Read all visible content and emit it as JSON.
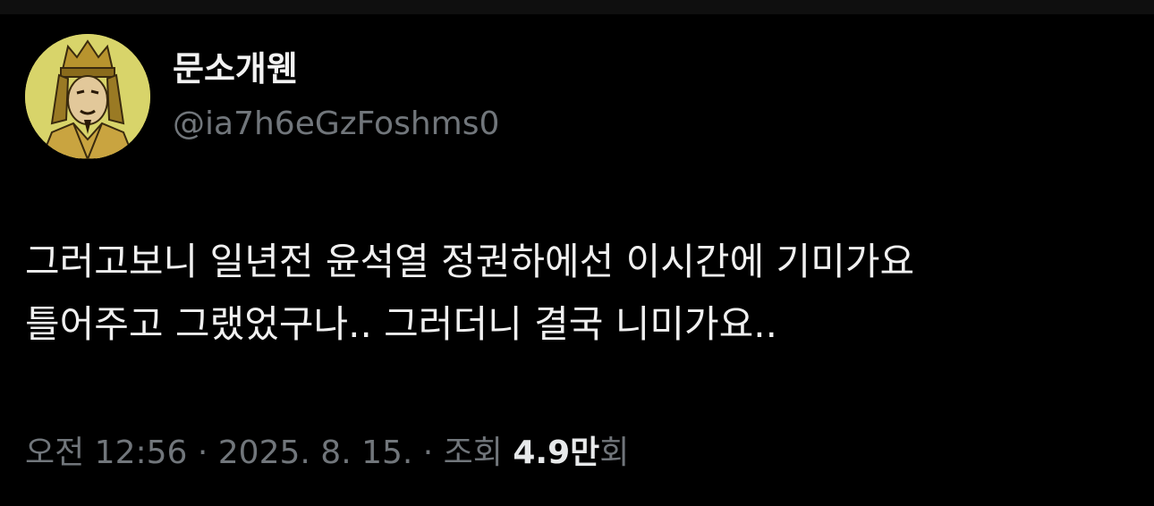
{
  "author": {
    "display_name": "문소개웬",
    "handle": "@ia7h6eGzFoshms0",
    "avatar_icon": "profile-avatar-illustration"
  },
  "tweet": {
    "lines": [
      "그러고보니 일년전 윤석열 정권하에선 이시간에 기미가요",
      "틀어주고 그랬었구나.. 그러더니 결국 니미가요.."
    ]
  },
  "meta": {
    "time": "오전 12:56",
    "separator1": " · ",
    "date": "2025. 8. 15.",
    "separator2": " · ",
    "views_label": "조회 ",
    "views_count": "4.9만",
    "views_suffix": "회"
  },
  "colors": {
    "background": "#000000",
    "primary_text": "#e7e9ea",
    "secondary_text": "#71767b",
    "avatar_bg": "#d8d46a"
  }
}
